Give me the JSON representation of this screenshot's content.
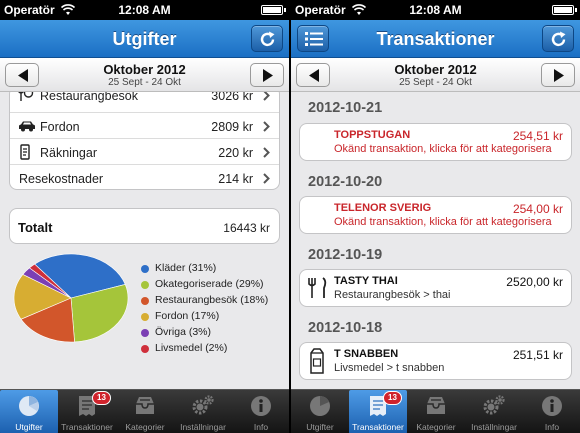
{
  "status": {
    "carrier": "Operatör",
    "time": "12:08 AM"
  },
  "period": {
    "month": "Oktober 2012",
    "range": "25 Sept - 24 Okt"
  },
  "left": {
    "title": "Utgifter",
    "categories": [
      {
        "name": "Restaurangbesök",
        "amount": "3026 kr",
        "icon": "fork-knife-icon"
      },
      {
        "name": "Fordon",
        "amount": "2809 kr",
        "icon": "car-icon"
      },
      {
        "name": "Räkningar",
        "amount": "220 kr",
        "icon": "bill-icon"
      },
      {
        "name": "Resekostnader",
        "amount": "214 kr",
        "icon": ""
      }
    ],
    "total": {
      "label": "Totalt",
      "value": "16443 kr"
    },
    "legend": [
      {
        "label": "Kläder (31%)",
        "color": "#2e6fc8",
        "value": 31
      },
      {
        "label": "Okategoriserade (29%)",
        "color": "#a5c53a",
        "value": 29
      },
      {
        "label": "Restaurangbesök (18%)",
        "color": "#d2562b",
        "value": 18
      },
      {
        "label": "Fordon (17%)",
        "color": "#d7ad32",
        "value": 17
      },
      {
        "label": "Övriga (3%)",
        "color": "#7b3fb4",
        "value": 3
      },
      {
        "label": "Livsmedel (2%)",
        "color": "#cf2f3b",
        "value": 2
      }
    ]
  },
  "right": {
    "title": "Transaktioner",
    "groups": [
      {
        "date": "2012-10-21",
        "tx": {
          "name": "TOPPSTUGAN",
          "amount": "254,51 kr",
          "sub": "Okänd transaktion, klicka för att kategorisera",
          "style": "unknown",
          "icon": ""
        }
      },
      {
        "date": "2012-10-20",
        "tx": {
          "name": "TELENOR SVERIG",
          "amount": "254,00 kr",
          "sub": "Okänd transaktion, klicka för att kategorisera",
          "style": "unknown",
          "icon": ""
        }
      },
      {
        "date": "2012-10-19",
        "tx": {
          "name": "TASTY THAI",
          "amount": "2520,00 kr",
          "sub": "Restaurangbesök > thai",
          "style": "known",
          "icon": "fork-knife-icon"
        }
      },
      {
        "date": "2012-10-18",
        "tx": {
          "name": "T SNABBEN",
          "amount": "251,51 kr",
          "sub": "Livsmedel > t snabben",
          "style": "known",
          "icon": "milk-carton-icon"
        }
      }
    ]
  },
  "tabs": [
    {
      "label": "Utgifter",
      "icon": "pie-chart-icon"
    },
    {
      "label": "Transaktioner",
      "icon": "receipt-icon",
      "badge": "13"
    },
    {
      "label": "Kategorier",
      "icon": "inbox-tray-icon"
    },
    {
      "label": "Inställningar",
      "icon": "gears-icon"
    },
    {
      "label": "Info",
      "icon": "info-icon"
    }
  ]
}
